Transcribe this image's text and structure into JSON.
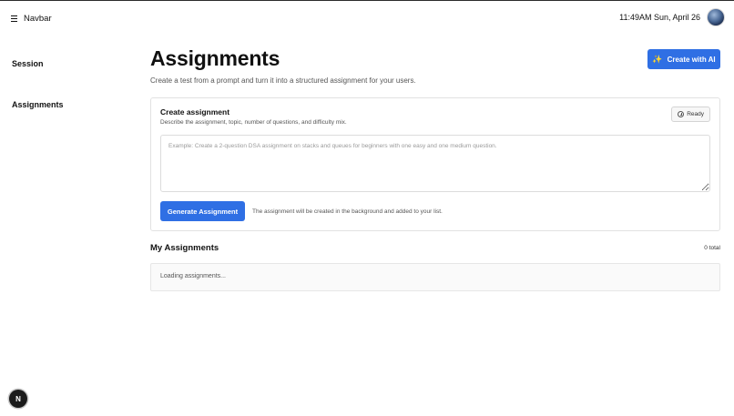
{
  "navbar": {
    "menu_icon": "menu-icon",
    "title": "Navbar",
    "clock": "11:49AM Sun, April 26",
    "avatar_icon": "avatar"
  },
  "sidebar": {
    "items": [
      {
        "label": "Session"
      },
      {
        "label": "Assignments"
      }
    ]
  },
  "main": {
    "title": "Assignments",
    "subtitle": "Create a test from a prompt and turn it into a structured assignment for your users.",
    "create_ai_button": {
      "label": "Create with AI",
      "icon": "sparkle-icon"
    }
  },
  "create_card": {
    "title": "Create assignment",
    "description": "Describe the assignment, topic, number of questions, and difficulty mix.",
    "status_badge": "Ready",
    "prompt_placeholder": "Example: Create a 2-question DSA assignment on stacks and queues for beginners with one easy and one medium question.",
    "prompt_value": "",
    "generate_button": "Generate Assignment",
    "note": "The assignment will be created in the background and added to your list."
  },
  "my_assignments": {
    "title": "My Assignments",
    "total": "0 total",
    "loading_text": "Loading assignments..."
  },
  "floating_badge": {
    "label": "N"
  },
  "colors": {
    "primary": "#2f6fe4",
    "text": "#111111",
    "muted": "#555555",
    "border": "#e2e2e2"
  }
}
